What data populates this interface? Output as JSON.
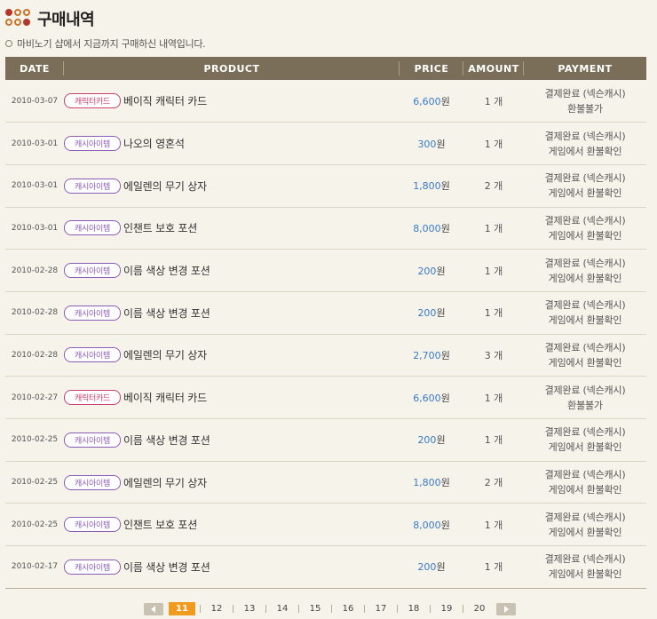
{
  "header": {
    "title": "구매내역",
    "icon": "three-dots-icon"
  },
  "subtitle": "마비노기 샵에서 지금까지 구매하신 내역입니다.",
  "table": {
    "columns": {
      "date": "DATE",
      "product": "PRODUCT",
      "price": "PRICE",
      "amount": "AMOUNT",
      "payment": "PAYMENT"
    },
    "rows": [
      {
        "date": "2010-03-07",
        "tag": "캐릭터카드",
        "tag_color": "#c8406b",
        "product": "베이직 캐릭터 카드",
        "price": "6,600",
        "won": "원",
        "amount": "1 개",
        "pay1": "결제완료 (넥슨캐시)",
        "pay2": "환불불가"
      },
      {
        "date": "2010-03-01",
        "tag": "캐시아이템",
        "tag_color": "#8a5cb6",
        "product": "나오의 영혼석",
        "price": "300",
        "won": "원",
        "amount": "1 개",
        "pay1": "결제완료 (넥슨캐시)",
        "pay2": "게임에서 환불확인"
      },
      {
        "date": "2010-03-01",
        "tag": "캐시아이템",
        "tag_color": "#8a5cb6",
        "product": "에일렌의 무기 상자",
        "price": "1,800",
        "won": "원",
        "amount": "2 개",
        "pay1": "결제완료 (넥슨캐시)",
        "pay2": "게임에서 환불확인"
      },
      {
        "date": "2010-03-01",
        "tag": "캐시아이템",
        "tag_color": "#8a5cb6",
        "product": "인챈트 보호 포션",
        "price": "8,000",
        "won": "원",
        "amount": "1 개",
        "pay1": "결제완료 (넥슨캐시)",
        "pay2": "게임에서 환불확인"
      },
      {
        "date": "2010-02-28",
        "tag": "캐시아이템",
        "tag_color": "#8a5cb6",
        "product": "이름 색상 변경 포션",
        "price": "200",
        "won": "원",
        "amount": "1 개",
        "pay1": "결제완료 (넥슨캐시)",
        "pay2": "게임에서 환불확인"
      },
      {
        "date": "2010-02-28",
        "tag": "캐시아이템",
        "tag_color": "#8a5cb6",
        "product": "이름 색상 변경 포션",
        "price": "200",
        "won": "원",
        "amount": "1 개",
        "pay1": "결제완료 (넥슨캐시)",
        "pay2": "게임에서 환불확인"
      },
      {
        "date": "2010-02-28",
        "tag": "캐시아이템",
        "tag_color": "#8a5cb6",
        "product": "에일렌의 무기 상자",
        "price": "2,700",
        "won": "원",
        "amount": "3 개",
        "pay1": "결제완료 (넥슨캐시)",
        "pay2": "게임에서 환불확인"
      },
      {
        "date": "2010-02-27",
        "tag": "캐릭터카드",
        "tag_color": "#c8406b",
        "product": "베이직 캐릭터 카드",
        "price": "6,600",
        "won": "원",
        "amount": "1 개",
        "pay1": "결제완료 (넥슨캐시)",
        "pay2": "환불불가"
      },
      {
        "date": "2010-02-25",
        "tag": "캐시아이템",
        "tag_color": "#8a5cb6",
        "product": "이름 색상 변경 포션",
        "price": "200",
        "won": "원",
        "amount": "1 개",
        "pay1": "결제완료 (넥슨캐시)",
        "pay2": "게임에서 환불확인"
      },
      {
        "date": "2010-02-25",
        "tag": "캐시아이템",
        "tag_color": "#8a5cb6",
        "product": "에일렌의 무기 상자",
        "price": "1,800",
        "won": "원",
        "amount": "2 개",
        "pay1": "결제완료 (넥슨캐시)",
        "pay2": "게임에서 환불확인"
      },
      {
        "date": "2010-02-25",
        "tag": "캐시아이템",
        "tag_color": "#8a5cb6",
        "product": "인챈트 보호 포션",
        "price": "8,000",
        "won": "원",
        "amount": "1 개",
        "pay1": "결제완료 (넥슨캐시)",
        "pay2": "게임에서 환불확인"
      },
      {
        "date": "2010-02-17",
        "tag": "캐시아이템",
        "tag_color": "#8a5cb6",
        "product": "이름 색상 변경 포션",
        "price": "200",
        "won": "원",
        "amount": "1 개",
        "pay1": "결제완료 (넥슨캐시)",
        "pay2": "게임에서 환불확인"
      }
    ]
  },
  "pagination": {
    "prev_icon": "arrow-left-icon",
    "next_icon": "arrow-right-icon",
    "current": "11",
    "pages": [
      "11",
      "12",
      "13",
      "14",
      "15",
      "16",
      "17",
      "18",
      "19",
      "20"
    ]
  },
  "colors": {
    "header_bg": "#7a6e59",
    "accent": "#f09a1f",
    "price": "#3a7bc8",
    "background": "#f6f3ea"
  }
}
